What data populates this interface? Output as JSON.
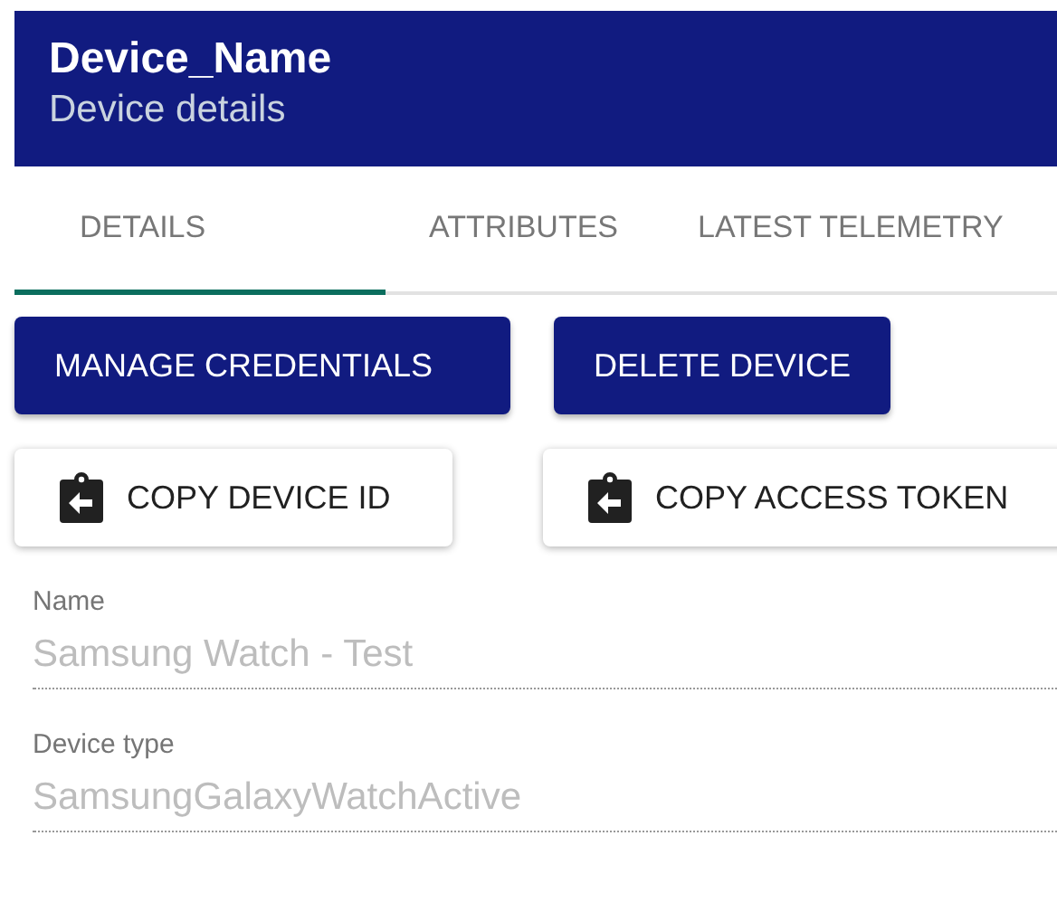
{
  "header": {
    "title": "Device_Name",
    "subtitle": "Device details"
  },
  "tabs": [
    {
      "label": "DETAILS",
      "selected": true
    },
    {
      "label": "ATTRIBUTES",
      "selected": false
    },
    {
      "label": "LATEST TELEMETRY",
      "selected": false
    }
  ],
  "action_buttons": [
    {
      "label": "MANAGE CREDENTIALS",
      "kind": "primary"
    },
    {
      "label": "DELETE DEVICE",
      "kind": "primary"
    },
    {
      "label": "COPY DEVICE ID",
      "kind": "copy"
    },
    {
      "label": "COPY ACCESS TOKEN",
      "kind": "copy"
    }
  ],
  "fields": [
    {
      "label": "Name",
      "value": "Samsung Watch - Test",
      "disabled": true
    },
    {
      "label": "Device type",
      "value": "SamsungGalaxyWatchActive",
      "disabled": true
    }
  ]
}
